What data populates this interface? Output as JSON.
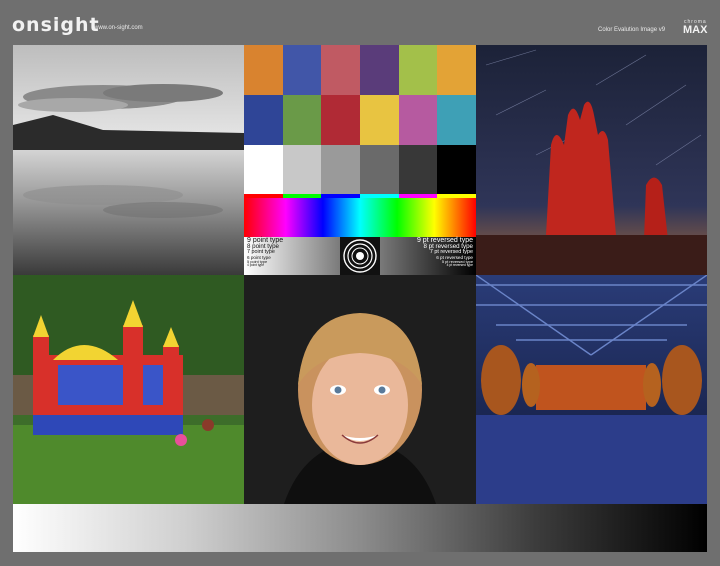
{
  "header": {
    "logo": "onsight",
    "website": "www.on-sight.com",
    "title": "Color Evalution Image v9",
    "brand_top": "chroma",
    "brand_main": "MAX"
  },
  "color_chart": {
    "swatches": [
      "#d9832f",
      "#4156a8",
      "#c05a63",
      "#5a3c7a",
      "#a3c04a",
      "#e3a336",
      "#2f4597",
      "#6a9a48",
      "#b02a35",
      "#e8c441",
      "#b65aa0",
      "#3ea0b6",
      "#ffffff",
      "#c8c8c8",
      "#9a9a9a",
      "#6a6a6a",
      "#383838",
      "#000000",
      "#ff0000",
      "#00ff00",
      "#0000ff",
      "#00ffff",
      "#ff00ff",
      "#ffff00"
    ],
    "type_left": [
      "9 point type",
      "8 point type",
      "7 point type",
      "6 point type",
      "5 point type",
      "4 point type"
    ],
    "type_right": [
      "9 pt reversed type",
      "8 pt reversed type",
      "7 pt reversed type",
      "6 pt reversed type",
      "5 pt reversed type",
      "4 pt reversed type"
    ]
  }
}
